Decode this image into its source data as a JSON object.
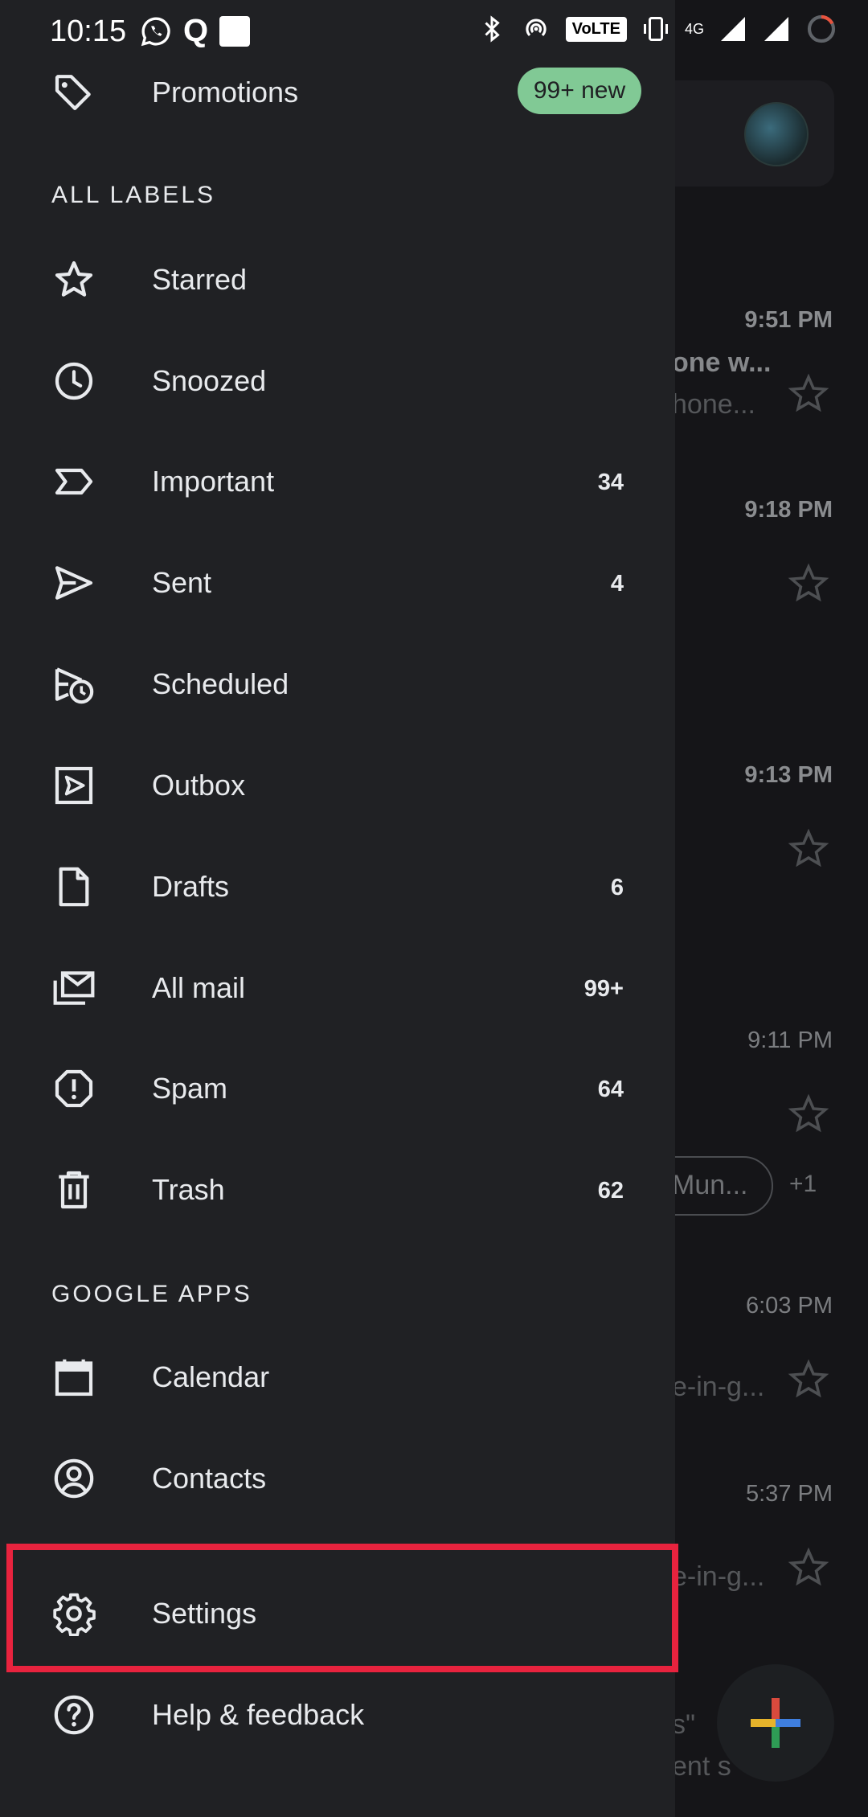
{
  "status_bar": {
    "time": "10:15",
    "q_glyph": "Q",
    "volte": "VoLTE",
    "network": "4G"
  },
  "drawer": {
    "promotions": {
      "label": "Promotions",
      "badge": "99+ new"
    },
    "all_labels_header": "ALL LABELS",
    "labels": [
      {
        "label": "Starred",
        "count": "",
        "icon": "star-icon"
      },
      {
        "label": "Snoozed",
        "count": "",
        "icon": "clock-icon"
      },
      {
        "label": "Important",
        "count": "34",
        "icon": "important-icon"
      },
      {
        "label": "Sent",
        "count": "4",
        "icon": "send-icon"
      },
      {
        "label": "Scheduled",
        "count": "",
        "icon": "scheduled-icon"
      },
      {
        "label": "Outbox",
        "count": "",
        "icon": "outbox-icon"
      },
      {
        "label": "Drafts",
        "count": "6",
        "icon": "draft-icon"
      },
      {
        "label": "All mail",
        "count": "99+",
        "icon": "all-mail-icon"
      },
      {
        "label": "Spam",
        "count": "64",
        "icon": "spam-icon"
      },
      {
        "label": "Trash",
        "count": "62",
        "icon": "trash-icon"
      }
    ],
    "google_apps_header": "GOOGLE APPS",
    "apps": [
      {
        "label": "Calendar",
        "icon": "calendar-icon"
      },
      {
        "label": "Contacts",
        "icon": "contacts-icon"
      }
    ],
    "settings": {
      "label": "Settings",
      "icon": "gear-icon"
    },
    "help": {
      "label": "Help & feedback",
      "icon": "help-icon"
    }
  },
  "background_inbox": {
    "times": [
      "9:51 PM",
      "9:18 PM",
      "9:13 PM",
      "9:11 PM",
      "6:03 PM",
      "5:37 PM"
    ],
    "snippets": [
      "one w...",
      "hone...",
      "e-in-g...",
      "e-in-g...",
      "s\"",
      "ent s"
    ],
    "chip": "Mun...",
    "chip_more": "+1"
  },
  "colors": {
    "drawer_bg": "#202124",
    "promo_badge": "#81c995",
    "highlight": "#e8233e"
  }
}
